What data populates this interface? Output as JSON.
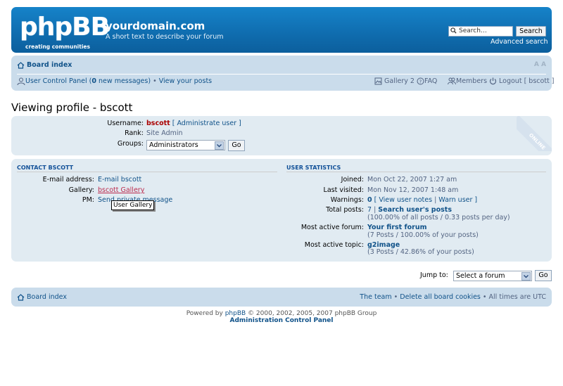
{
  "header": {
    "logo_text": "phpBB",
    "logo_sub": "creating  communities",
    "site_name": "yourdomain.com",
    "site_desc": "A short text to describe your forum",
    "search_placeholder": "Search…",
    "search_button": "Search",
    "advanced_search": "Advanced search"
  },
  "navbar": {
    "board_index": "Board index",
    "font_size_icons": "A A",
    "ucp": "User Control Panel (",
    "new_messages_count": "0",
    "new_messages_suffix": " new messages)",
    "bullet": " • ",
    "view_posts": "View your posts",
    "gallery": "Gallery 2",
    "faq": "FAQ",
    "members": "Members",
    "logout": "Logout [ bscott ]"
  },
  "page": {
    "title": "Viewing profile - bscott"
  },
  "profile": {
    "username_label": "Username:",
    "username": "bscott",
    "admin_user_link": "[ Administrate user ]",
    "rank_label": "Rank:",
    "rank": "Site Admin",
    "groups_label": "Groups:",
    "groups_selected": "Administrators",
    "go_label": "Go",
    "online_badge": "ONLINE"
  },
  "contact": {
    "heading": "CONTACT BSCOTT",
    "email_label": "E-mail address:",
    "email_link": "E-mail bscott",
    "gallery_label": "Gallery:",
    "gallery_link": "bscott Gallery",
    "pm_label": "PM:",
    "pm_link": "Send private message",
    "tooltip": "User Gallery"
  },
  "stats": {
    "heading": "USER STATISTICS",
    "joined_label": "Joined:",
    "joined": "Mon Oct 22, 2007 1:27 am",
    "last_visited_label": "Last visited:",
    "last_visited": "Mon Nov 12, 2007 1:48 am",
    "warnings_label": "Warnings:",
    "warnings_count": "0",
    "view_notes": "[ View user notes",
    "warn_user": "Warn user ]",
    "total_posts_label": "Total posts:",
    "total_posts": "7",
    "search_posts": "Search user's posts",
    "total_posts_detail": "(100.00% of all posts / 0.33 posts per day)",
    "active_forum_label": "Most active forum:",
    "active_forum": "Your first forum",
    "active_forum_detail": "(7 Posts / 100.00% of your posts)",
    "active_topic_label": "Most active topic:",
    "active_topic": "g2image",
    "active_topic_detail": "(3 Posts / 42.86% of your posts)"
  },
  "jump": {
    "label": "Jump to:",
    "selected": "Select a forum",
    "go": "Go"
  },
  "footer": {
    "board_index": "Board index",
    "team": "The team",
    "delete_cookies": "Delete all board cookies",
    "timezone": "All times are UTC",
    "powered_prefix": "Powered by ",
    "phpbb": "phpBB",
    "powered_suffix": " © 2000, 2002, 2005, 2007 phpBB Group",
    "acp": "Administration Control Panel"
  },
  "colors": {
    "header": "#0f6cae",
    "navbar": "#cadceb",
    "panel": "#ecf1f3",
    "link": "#105289",
    "username": "#aa0000"
  }
}
